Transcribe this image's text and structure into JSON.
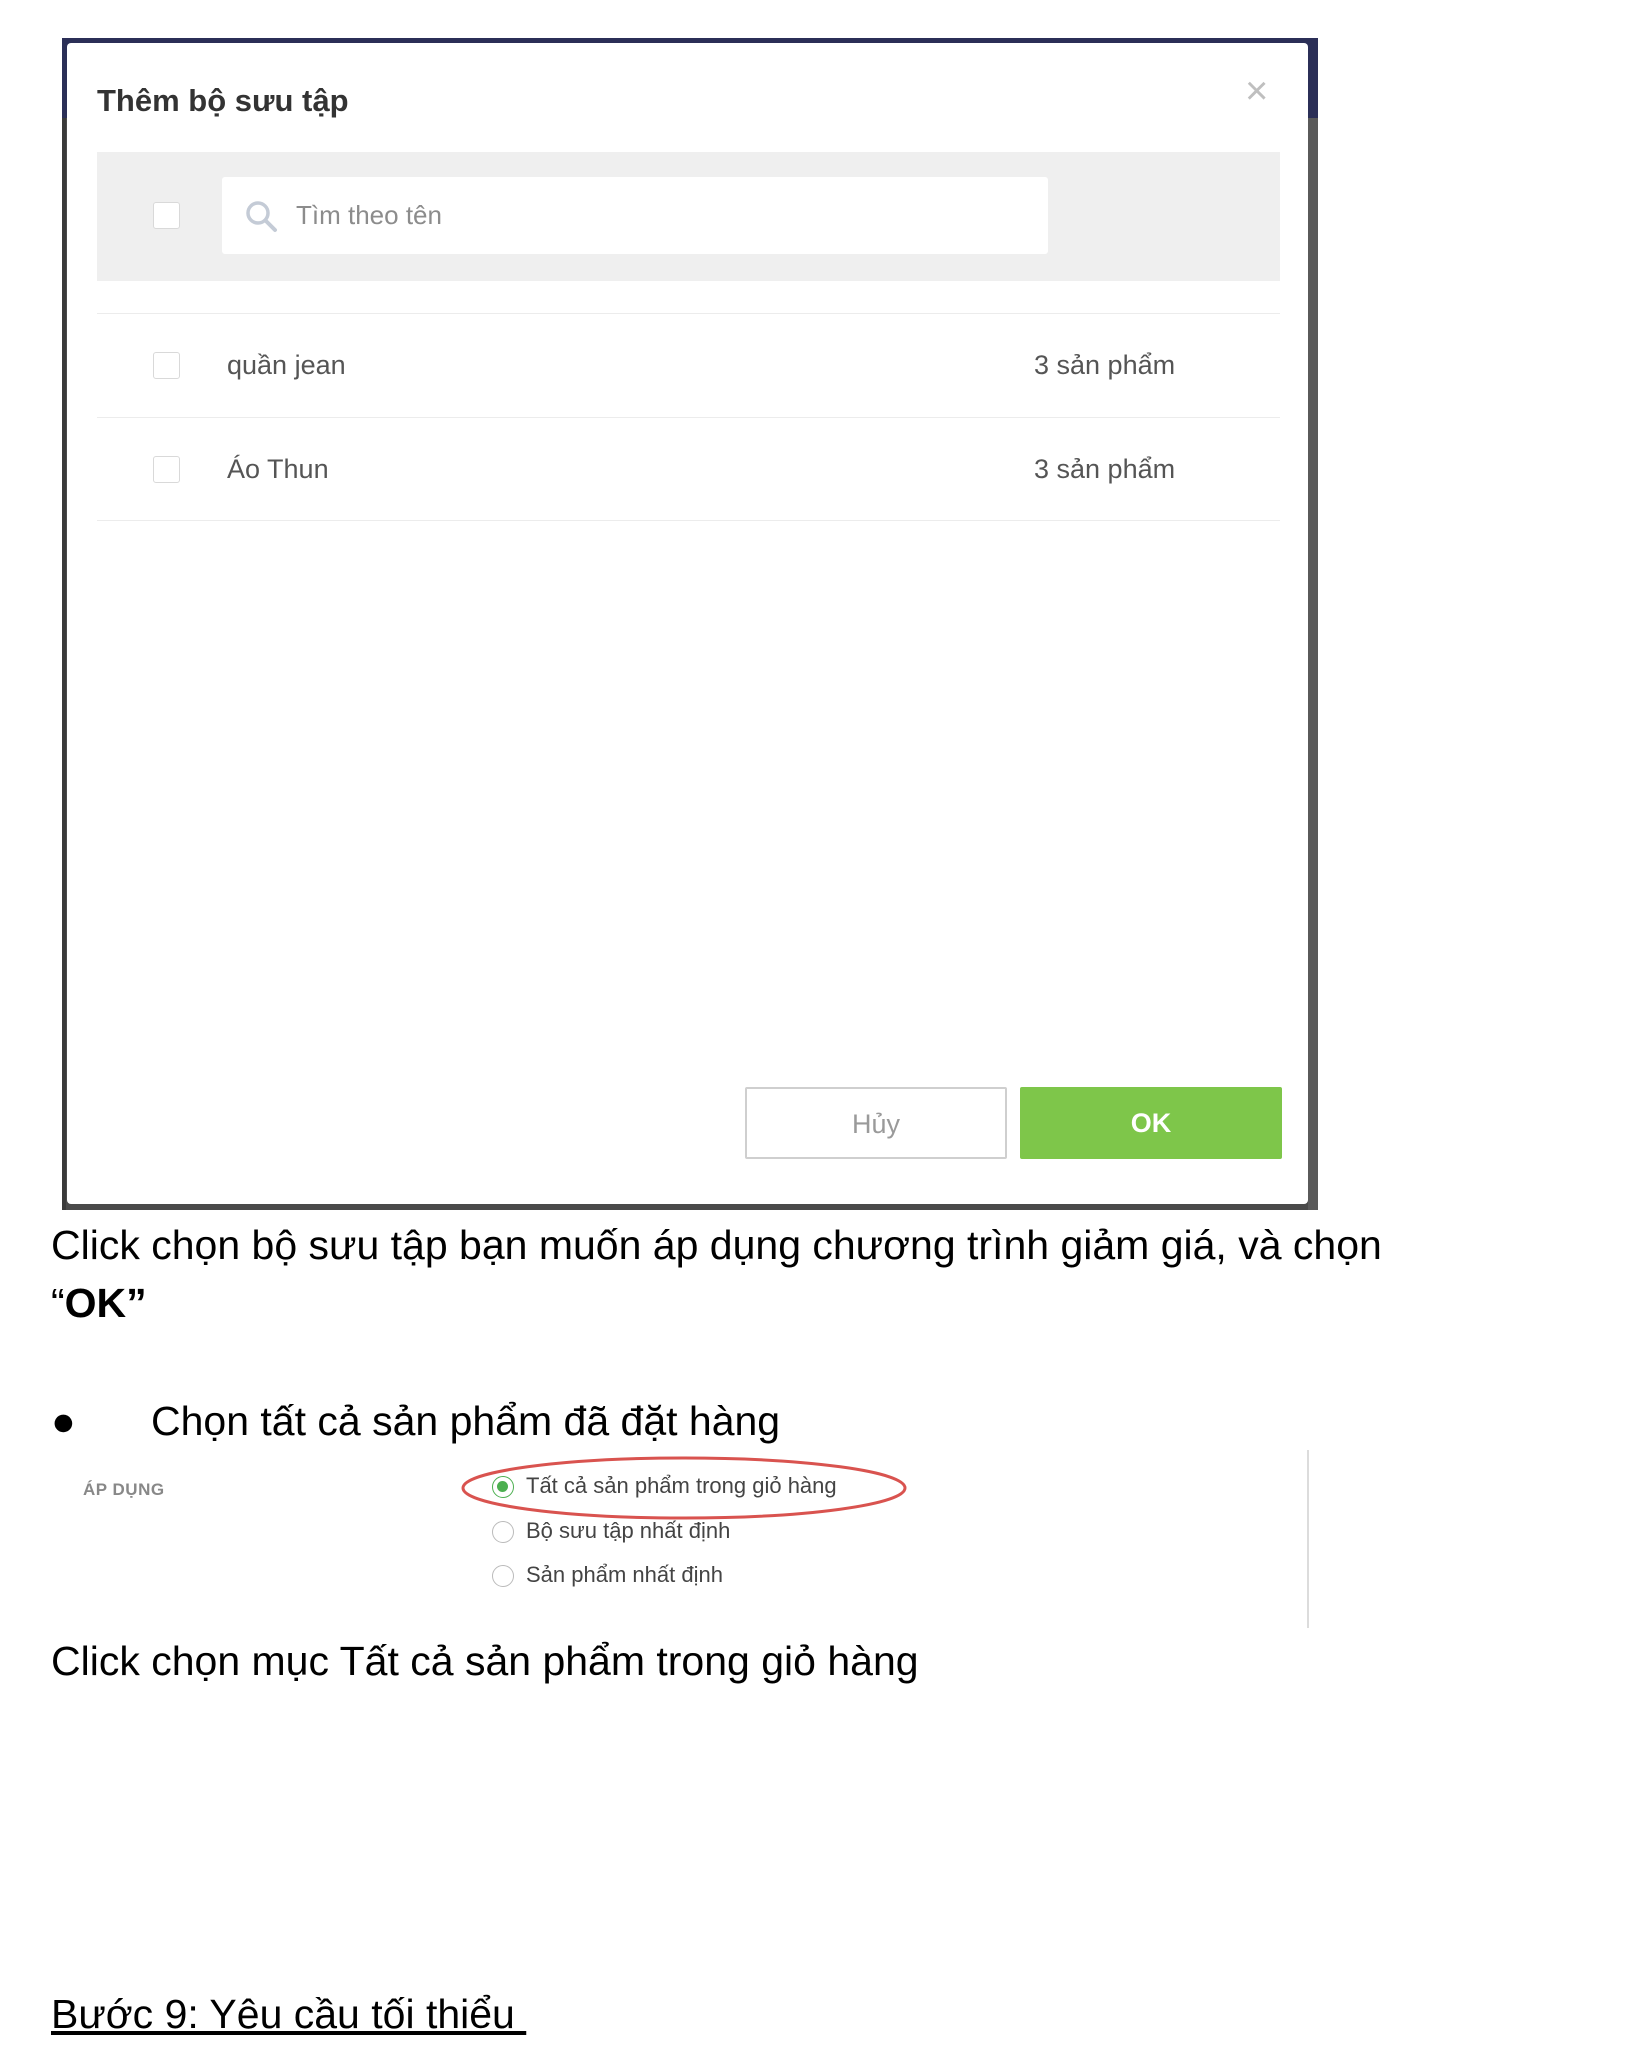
{
  "dialog": {
    "title": "Thêm bộ sưu tập",
    "close_glyph": "×",
    "search_placeholder": "Tìm theo tên",
    "rows": [
      {
        "name": "quần jean",
        "count": "3 sản phẩm"
      },
      {
        "name": "Áo Thun",
        "count": "3 sản phẩm"
      }
    ],
    "cancel_label": "Hủy",
    "ok_label": "OK",
    "accent_color": "#7ec64a"
  },
  "text": {
    "para1_part1": "Click chọn bộ sưu tập bạn muốn áp dụng chương trình giảm giá, và chọn",
    "para1_quote_open": "“",
    "para1_bold": "OK",
    "para1_quote_close": "”",
    "bullet_glyph": "●",
    "bullet_text": "Chọn tất cả sản phẩm đã đặt hàng",
    "para2": "Click chọn mục Tất cả sản phẩm trong giỏ hàng",
    "step_title": "Bước 9: Yêu cầu tối thiểu "
  },
  "apply": {
    "label": "ÁP DỤNG",
    "options": [
      {
        "label": "Tất cả sản phẩm trong giỏ hàng",
        "checked": true
      },
      {
        "label": "Bộ sưu tập nhất định",
        "checked": false
      },
      {
        "label": "Sản phẩm nhất định",
        "checked": false
      }
    ],
    "radio_color": "#4caf50",
    "highlight_color": "#d9534f"
  },
  "icons": {
    "search": "search-icon",
    "close": "close-icon"
  }
}
